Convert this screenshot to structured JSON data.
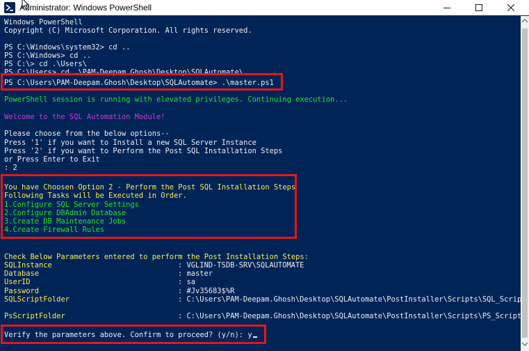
{
  "window": {
    "title": "Administrator: Windows PowerShell",
    "minimize_label": "—",
    "maximize_label": "☐",
    "close_label": "✕"
  },
  "colors": {
    "console_background": "#012456",
    "default_text": "#eeedf0",
    "green": "#1ee82c",
    "magenta": "#c53ad7",
    "yellow": "#f7e85a",
    "highlight": "#e5161f"
  },
  "console": {
    "header_1": "Windows PowerShell",
    "header_2": "Copyright (C) Microsoft Corporation. All rights reserved.",
    "cmd_1": "PS C:\\Windows\\system32> cd ..",
    "cmd_2": "PS C:\\Windows> cd ..",
    "cmd_3": "PS C:\\> cd .\\Users\\",
    "cmd_4": "PS C:\\Users> cd .\\PAM-Deepam.Ghosh\\Desktop\\SQLAutomate\\",
    "cmd_5": "PS C:\\Users\\PAM-Deepam.Ghosh\\Desktop\\SQLAutomate> .\\master.ps1",
    "elevated_msg": "PowerShell session is running with elevated privileges. Continuing execution...",
    "welcome_msg": "Welcome to the SQL Automation Module!",
    "menu_prompt": "Please choose from the below options--",
    "menu_option_1": "Press '1' if you want to Install a new SQL Server Instance",
    "menu_option_2": "Press '2' if you want to Perform the Post SQL Installation Steps",
    "menu_option_exit": "or Press Enter to Exit",
    "menu_input": ": 2",
    "chosen_msg": "You have Choosen Option 2 - Perform the Post SQL Installation Steps",
    "tasks_header": "Following Tasks will be Executed in Order.",
    "tasks": [
      "1.Configure SQL Server Settings",
      "2.Configure DBAdmin Database",
      "3.Create DB Maintenance Jobs",
      "4.Create Firewall Rules"
    ],
    "params_header": "Check Below Parameters entered to perform the Post Installation Steps:",
    "params": [
      {
        "name": "SQLInstance",
        "value": ": VGLIND-TSDB-SRV\\SQLAUTOMATE"
      },
      {
        "name": "Database",
        "value": ": master"
      },
      {
        "name": "UserID",
        "value": ": sa"
      },
      {
        "name": "Password",
        "value": ": #Jv35683$%R"
      },
      {
        "name": "SQLScriptFolder",
        "value": ": C:\\Users\\PAM-Deepam.Ghosh\\Desktop\\SQLAutomate\\PostInstaller\\Scripts\\SQL_Scripts"
      },
      {
        "name": "PsScriptFolder",
        "value": ": C:\\Users\\PAM-Deepam.Ghosh\\Desktop\\SQLAutomate\\PostInstaller\\Scripts\\PS_Scripts"
      }
    ],
    "confirm_prompt": "Verify the parameters above. Confirm to proceed? (y/n): ",
    "confirm_input": "y"
  }
}
